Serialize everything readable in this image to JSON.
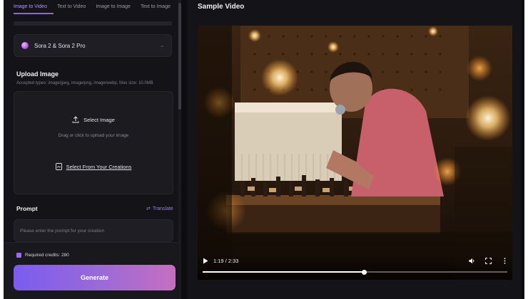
{
  "tabs": [
    {
      "label": "Image to Video",
      "active": true
    },
    {
      "label": "Text to Video",
      "active": false
    },
    {
      "label": "Image to Image",
      "active": false
    },
    {
      "label": "Text to Image",
      "active": false
    }
  ],
  "model": {
    "label": "Sora 2 & Sora 2 Pro"
  },
  "upload": {
    "title": "Upload Image",
    "hint": "Accepted types: image/jpeg, image/png, image/webp, Max size: 10.0MB",
    "select_label": "Select Image",
    "drag_text": "Drag or click to upload your image",
    "from_creations_label": "Select From Your Creations"
  },
  "prompt": {
    "title": "Prompt",
    "translate_label": "Translate",
    "placeholder": "Please enter the prompt for your creation"
  },
  "credits": {
    "label": "Required credits: 280"
  },
  "generate": {
    "label": "Generate"
  },
  "video": {
    "title": "Sample Video",
    "time": "1:19 / 2:33",
    "progress": 0.53
  },
  "colors": {
    "accent": "#8c63f7",
    "generate_start": "#7a5cf0",
    "generate_end": "#c66ec0"
  }
}
